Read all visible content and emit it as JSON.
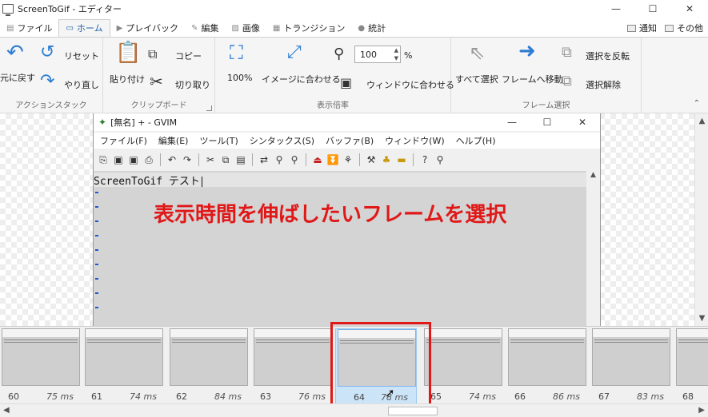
{
  "window": {
    "title": "ScreenToGif - エディター",
    "minimize": "—",
    "maximize": "☐",
    "close": "✕"
  },
  "tabs": [
    {
      "label": "ファイル",
      "icon": "file-icon"
    },
    {
      "label": "ホーム",
      "icon": "home-icon"
    },
    {
      "label": "プレイバック",
      "icon": "play-icon"
    },
    {
      "label": "編集",
      "icon": "edit-icon"
    },
    {
      "label": "画像",
      "icon": "image-icon"
    },
    {
      "label": "トランジション",
      "icon": "transition-icon"
    },
    {
      "label": "統計",
      "icon": "info-icon"
    }
  ],
  "tabs_right": {
    "notify": "通知",
    "other": "その他"
  },
  "ribbon": {
    "action_stack": {
      "label": "アクションスタック",
      "undo": "元に戻す",
      "reset": "リセット",
      "redo": "やり直し"
    },
    "clipboard": {
      "label": "クリップボード",
      "paste": "貼り付け",
      "copy": "コピー",
      "cut": "切り取り"
    },
    "zoom": {
      "label": "表示倍率",
      "pct100": "100%",
      "fit_image": "イメージに合わせる",
      "fit_window": "ウィンドウに合わせる",
      "value": "100",
      "unit": "%"
    },
    "frame_select": {
      "label": "フレーム選択",
      "select_all": "すべて選択",
      "go_to_frame": "フレームへ移動",
      "invert": "選択を反転",
      "deselect": "選択解除"
    }
  },
  "gvim": {
    "title": "[無名] + - GVIM",
    "menu": [
      "ファイル(F)",
      "編集(E)",
      "ツール(T)",
      "シンタックス(S)",
      "バッファ(B)",
      "ウィンドウ(W)",
      "ヘルプ(H)"
    ],
    "text_line": "ScreenToGif テスト"
  },
  "annotation": "表示時間を伸ばしたいフレームを選択",
  "frames": [
    {
      "num": "60",
      "dur": "75 ms"
    },
    {
      "num": "61",
      "dur": "74 ms"
    },
    {
      "num": "62",
      "dur": "84 ms"
    },
    {
      "num": "63",
      "dur": "76 ms"
    },
    {
      "num": "64",
      "dur": "78 ms",
      "selected": true
    },
    {
      "num": "65",
      "dur": "74 ms"
    },
    {
      "num": "66",
      "dur": "86 ms"
    },
    {
      "num": "67",
      "dur": "83 ms"
    },
    {
      "num": "68",
      "dur": ""
    }
  ],
  "colors": {
    "accent": "#2d7dd2",
    "annotation": "#e01818",
    "selection": "#cce4f7"
  }
}
